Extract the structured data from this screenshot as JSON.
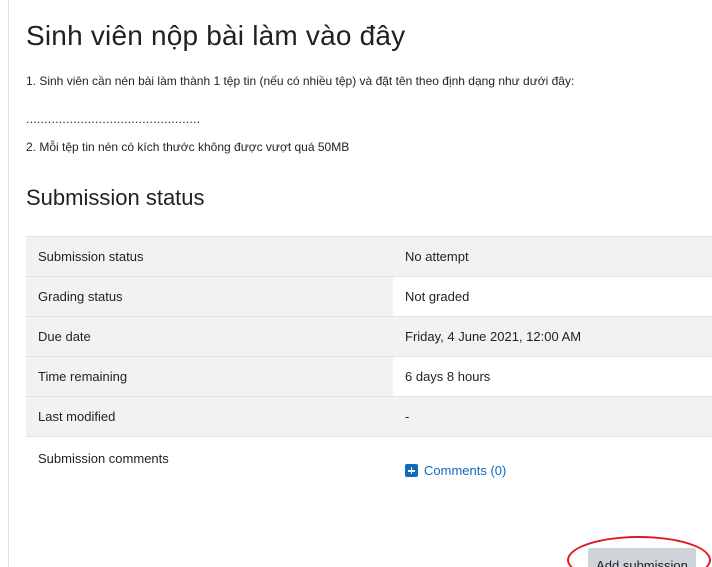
{
  "page": {
    "title": "Sinh viên nộp bài làm vào đây",
    "instructions": [
      "1. Sinh viên cần nén bài làm thành 1 tệp tin (nếu có nhiều tệp) và đặt tên theo định dạng như dưới đây:",
      "................................................",
      "2. Mỗi tệp tin nén có kích thước không được vượt quá 50MB"
    ]
  },
  "submission": {
    "heading": "Submission status",
    "rows": [
      {
        "label": "Submission status",
        "value": "No attempt"
      },
      {
        "label": "Grading status",
        "value": "Not graded"
      },
      {
        "label": "Due date",
        "value": "Friday, 4 June 2021, 12:00 AM"
      },
      {
        "label": "Time remaining",
        "value": "6 days 8 hours"
      },
      {
        "label": "Last modified",
        "value": "-"
      },
      {
        "label": "Submission comments",
        "value": ""
      }
    ],
    "comments_link": "Comments (0)",
    "comments_icon": "plus-square-icon",
    "add_button": "Add submission"
  },
  "colors": {
    "link": "#0f6cbf",
    "annotation": "#e0171f",
    "button_bg": "#ced4da",
    "row_shade": "#f2f2f2"
  }
}
